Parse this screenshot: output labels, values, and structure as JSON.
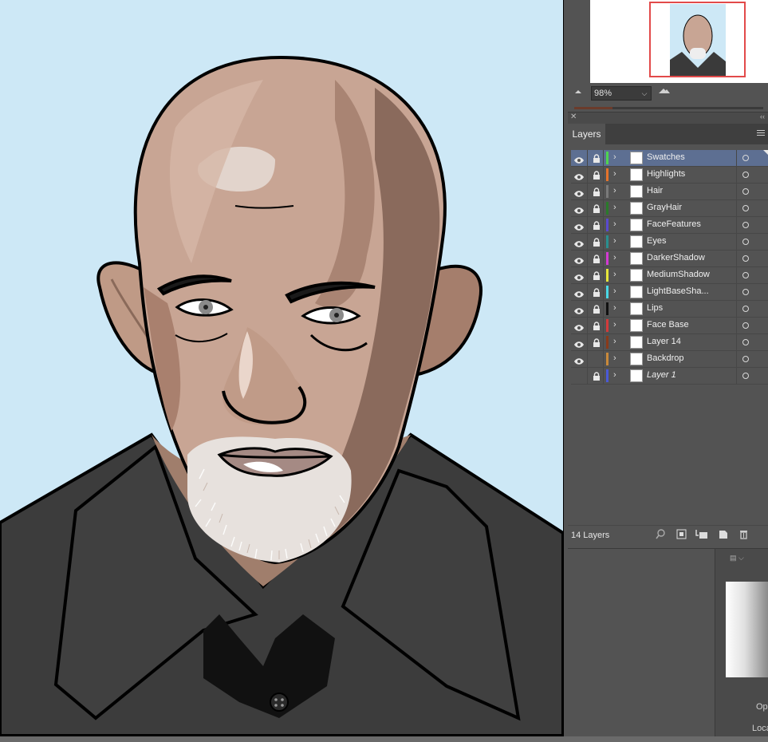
{
  "navigator": {
    "zoom_value": "98%"
  },
  "layers_panel": {
    "tab_label": "Layers",
    "count_label": "14 Layers",
    "layers": [
      {
        "name": "Swatches",
        "color": "#4fd44f",
        "visible": true,
        "locked": true,
        "selected": true
      },
      {
        "name": "Highlights",
        "color": "#e5732b",
        "visible": true,
        "locked": true,
        "selected": false
      },
      {
        "name": "Hair",
        "color": "#7a7a7a",
        "visible": true,
        "locked": true,
        "selected": false
      },
      {
        "name": "GrayHair",
        "color": "#2a7a2a",
        "visible": true,
        "locked": true,
        "selected": false
      },
      {
        "name": "FaceFeatures",
        "color": "#5a4ad0",
        "visible": true,
        "locked": true,
        "selected": false
      },
      {
        "name": "Eyes",
        "color": "#2a8f8f",
        "visible": true,
        "locked": true,
        "selected": false
      },
      {
        "name": "DarkerShadow",
        "color": "#d33bd3",
        "visible": true,
        "locked": true,
        "selected": false
      },
      {
        "name": "MediumShadow",
        "color": "#e6e63a",
        "visible": true,
        "locked": true,
        "selected": false
      },
      {
        "name": "LightBaseSha...",
        "color": "#4ad8e6",
        "visible": true,
        "locked": true,
        "selected": false
      },
      {
        "name": "Lips",
        "color": "#111111",
        "visible": true,
        "locked": true,
        "selected": false
      },
      {
        "name": "Face Base",
        "color": "#d33b3b",
        "visible": true,
        "locked": true,
        "selected": false
      },
      {
        "name": "Layer 14",
        "color": "#8a3a1a",
        "visible": true,
        "locked": true,
        "selected": false
      },
      {
        "name": "Backdrop",
        "color": "#c9893a",
        "visible": true,
        "locked": false,
        "selected": false
      },
      {
        "name": "Layer 1",
        "color": "#4a5ad8",
        "visible": false,
        "locked": true,
        "selected": false,
        "italic": true
      }
    ]
  },
  "lower_panel": {
    "opacity_label": "Op",
    "location_label": "Loca"
  },
  "colors": {
    "artboard_bg": "#cde8f6",
    "panel_bg": "#535353",
    "selection": "#5d6f92",
    "navigator_frame": "#e24a4a"
  }
}
